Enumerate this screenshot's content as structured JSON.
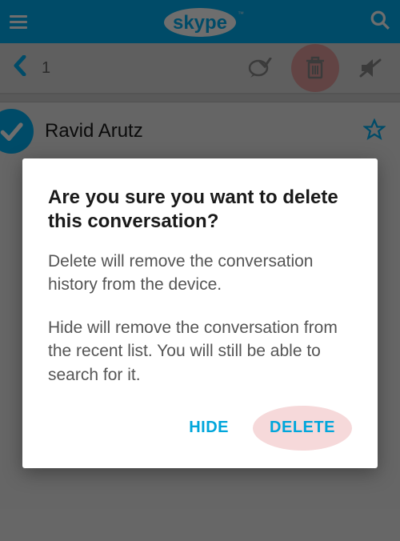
{
  "header": {
    "logo_text": "skype",
    "logo_tm": "™"
  },
  "toolbar": {
    "selected_count": "1"
  },
  "contact": {
    "name": "Ravid Arutz"
  },
  "modal": {
    "title": "Are you sure you want to delete this conversation?",
    "para1": "Delete will remove the conversation history from the device.",
    "para2": "Hide will remove the conversation from the recent list. You will still be able to search for it.",
    "hide_label": "HIDE",
    "delete_label": "DELETE"
  }
}
